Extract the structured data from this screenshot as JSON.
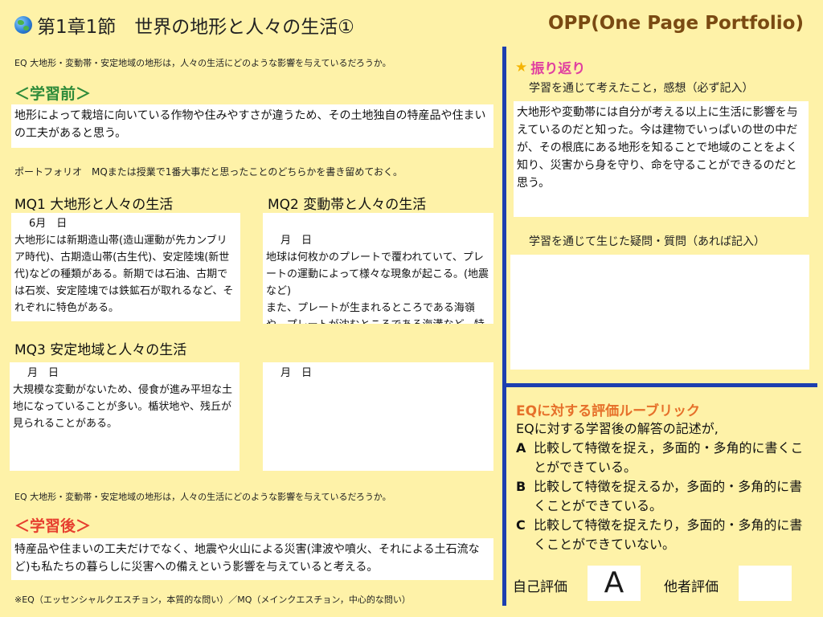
{
  "header": {
    "title": "第1章1節　世界の地形と人々の生活①",
    "opp": "OPP(One Page Portfolio)"
  },
  "eq_question": "EQ 大地形・変動帯・安定地域の地形は，人々の生活にどのような影響を与えているだろうか。",
  "before": {
    "heading": "＜学習前＞",
    "text": "地形によって栽培に向いている作物や住みやすさが違うため、その土地独自の特産品や住まいの工夫があると思う。"
  },
  "portfolio_note": "ポートフォリオ　MQまたは授業で1番大事だと思ったことのどちらかを書き留めておく。",
  "mq": [
    {
      "heading": "MQ1 大地形と人々の生活",
      "date": "6月　日",
      "text": "大地形には新期造山帯(造山運動が先カンブリア時代)、古期造山帯(古生代)、安定陸塊(新世代)などの種類がある。新期では石油、古期では石炭、安定陸塊では鉄鉱石が取れるなど、それぞれに特色がある。"
    },
    {
      "heading": "MQ2 変動帯と人々の生活",
      "date": "月　日",
      "text": "地球は何枚かのプレートで覆われていて、プレートの運動によって様々な現象が起こる。(地震など)\nまた、プレートが生まれるところである海嶺や、プレートが沈むところである海溝など、特徴的な地形も見られる。"
    },
    {
      "heading": "MQ3 安定地域と人々の生活",
      "date": "月　日",
      "text": "大規模な変動がないため、侵食が進み平坦な土地になっていることが多い。楯状地や、残丘が見られることがある。"
    },
    {
      "heading": "",
      "date": "月　日",
      "text": ""
    }
  ],
  "after": {
    "heading": "＜学習後＞",
    "text": "特産品や住まいの工夫だけでなく、地震や火山による災害(津波や噴火、それによる土石流など)も私たちの暮らしに災害への備えという影響を与えていると考える。"
  },
  "footnote": "※EQ（エッセンシャルクエスチョン，本質的な問い）／MQ（メインクエスチョン，中心的な問い）",
  "reflection": {
    "heading": "振り返り",
    "star_icon": "star-icon",
    "thoughts_label": "学習を通じて考えたこと，感想（必ず記入）",
    "thoughts_text": "大地形や変動帯には自分が考える以上に生活に影響を与えているのだと知った。今は建物でいっぱいの世の中だが、その根底にある地形を知ることで地域のことをよく知り、災害から身を守り、命を守ることができるのだと思う。",
    "questions_label": "学習を通じて生じた疑問・質問（あれば記入）",
    "questions_text": ""
  },
  "rubric": {
    "heading": "EQに対する評価ルーブリック",
    "intro": "EQに対する学習後の解答の記述が,",
    "items": [
      {
        "key": "A",
        "text": "比較して特徴を捉え，多面的・多角的に書くことができている。"
      },
      {
        "key": "B",
        "text": "比較して特徴を捉えるか，多面的・多角的に書くことができている。"
      },
      {
        "key": "C",
        "text": "比較して特徴を捉えたり，多面的・多角的に書くことができていない。"
      }
    ]
  },
  "evaluation": {
    "self_label": "自己評価",
    "self_value": "A",
    "peer_label": "他者評価",
    "peer_value": ""
  },
  "colors": {
    "background": "#fef2a8",
    "divider": "#1c3fb0",
    "before_heading": "#2e8b3a",
    "after_heading": "#e63f2f",
    "opp_title": "#7a4a12",
    "reflection_heading": "#e040a0",
    "rubric_heading": "#e6702a"
  }
}
